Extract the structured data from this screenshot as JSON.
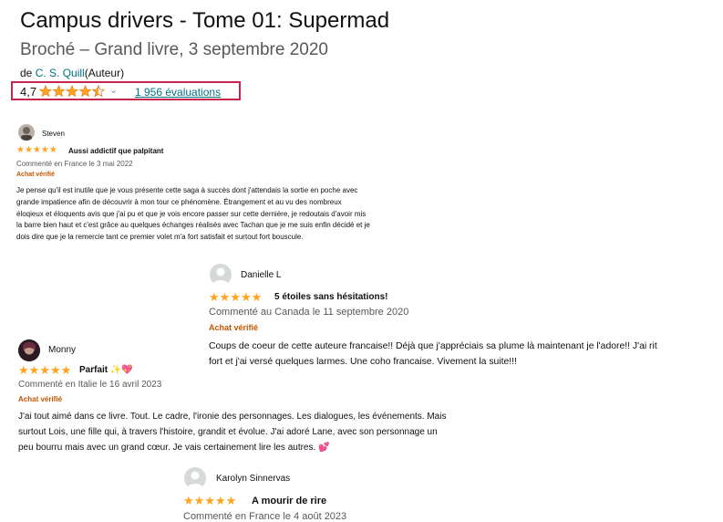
{
  "product": {
    "title": "Campus drivers - Tome 01: Supermad",
    "subtitle": "Broché – Grand livre, 3 septembre 2020",
    "by_prefix": "de",
    "author": "C. S. Quill",
    "author_role": "(Auteur)",
    "rating_value": "4,7",
    "rating_stars": 4.5,
    "rating_count": "1 956 évaluations"
  },
  "reviews": [
    {
      "user": "Steven",
      "stars": 5,
      "title": "Aussi addictif que palpitant",
      "meta": "Commenté en France le 3 mai 2022",
      "verified": "Achat vérifié",
      "lines": [
        "Je pense qu'il est inutile que je vous présente cette saga à succès dont j'attendais la sortie en poche avec",
        "grande impatience afin de découvrir à mon tour ce phénomène. Étrangement et au vu des nombreux",
        "éloqieux et éloquents avis que j'ai pu et que je vois encore passer sur cette dernière, je redoutais d'avoir mis",
        "la barre bien haut et c'est grâce au quelques échanges réalisés avec Tachan que je me suis enfin décidé et je",
        "dois dire que je la remercie tant ce premier volet m'a fort satisfait et surtout fort bouscule."
      ]
    },
    {
      "user": "Danielle L",
      "stars": 5,
      "title": "5 étoiles sans hésitations!",
      "meta": "Commenté au Canada le 11 septembre 2020",
      "verified": "Achat vérifié",
      "lines": [
        "Coups de coeur de cette auteure francaise!! Déjà que j'appréciais sa plume là maintenant je l'adore!! J'ai rit",
        "fort et j'ai versé quelques larmes. Une coho francaise. Vivement la suite!!!"
      ]
    },
    {
      "user": "Monny",
      "stars": 5,
      "title": "Parfait ✨💖",
      "meta": "Commenté en Italie le 16 avril 2023",
      "verified": "Achat vérifié",
      "lines": [
        "J'ai tout aimé dans ce livre. Tout. Le cadre, l'ironie des personnages. Les dialogues, les événements. Mais",
        "surtout Lois, une fille qui, à travers l'histoire, grandit et évolue. J'ai adoré Lane, avec son personnage un",
        "peu bourru mais avec un grand cœur. Je vais certainement lire les autres. 💕"
      ]
    },
    {
      "user": "Karolyn Sinnervas",
      "stars": 5,
      "title": "A mourir de rire",
      "meta": "Commenté en France le 4 août 2023",
      "verified": "",
      "lines": []
    }
  ],
  "colors": {
    "star": "#ffa41c",
    "link": "#007185",
    "verified": "#c45500",
    "highlight": "#c7254e"
  },
  "icons": {
    "star": "star-icon",
    "avatar": "user-avatar-icon",
    "chevron": "chevron-down-icon"
  }
}
